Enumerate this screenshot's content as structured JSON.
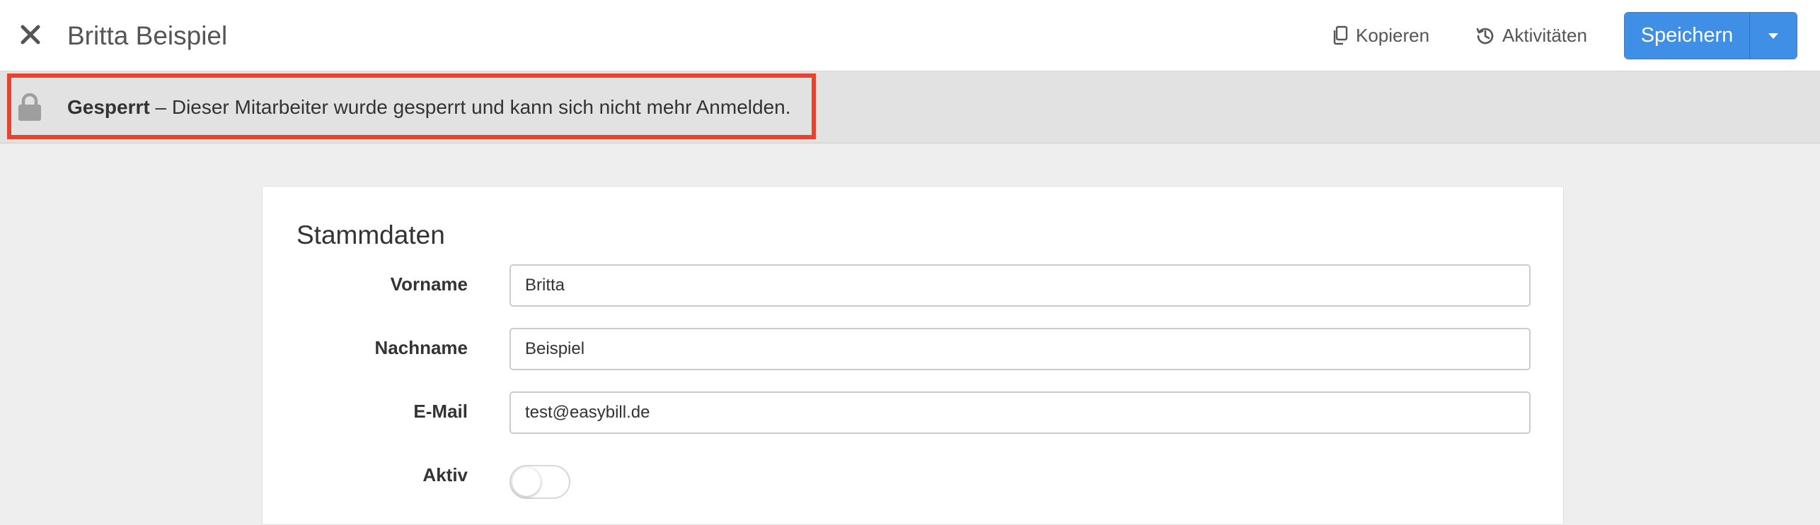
{
  "header": {
    "title": "Britta Beispiel",
    "copy_label": "Kopieren",
    "activities_label": "Aktivitäten",
    "save_label": "Speichern",
    "close_icon": "close-icon",
    "copy_icon": "copy-icon",
    "history_icon": "history-icon",
    "dropdown_icon": "caret-down-icon"
  },
  "lock_banner": {
    "icon": "lock-icon",
    "status": "Gesperrt",
    "message": " – Dieser Mitarbeiter wurde gesperrt und kann sich nicht mehr Anmelden.",
    "highlight_color": "#e8432d"
  },
  "form": {
    "section_title": "Stammdaten",
    "fields": [
      {
        "label": "Vorname",
        "value": "Britta"
      },
      {
        "label": "Nachname",
        "value": "Beispiel"
      },
      {
        "label": "E-Mail",
        "value": "test@easybill.de"
      }
    ],
    "active_label": "Aktiv",
    "active_on": false
  },
  "colors": {
    "primary": "#3f8fe6",
    "banner_bg": "#e2e2e2",
    "page_bg": "#eeeeee"
  }
}
